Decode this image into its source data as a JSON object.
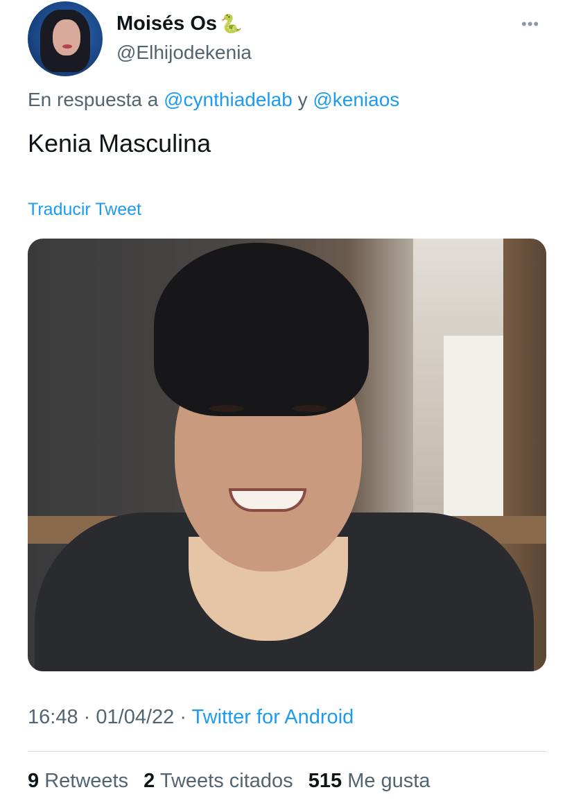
{
  "author": {
    "name": "Moisés Os",
    "emoji": "🐍",
    "handle": "@Elhijodekenia"
  },
  "reply": {
    "prefix": "En respuesta a",
    "user1": "@cynthiadelab",
    "conj": "y",
    "user2": "@keniaos"
  },
  "tweet": {
    "text": "Kenia Masculina",
    "translate_label": "Traducir Tweet"
  },
  "meta": {
    "time": "16:48",
    "date": "01/04/22",
    "source": "Twitter for Android",
    "sep": "·"
  },
  "stats": {
    "retweets_count": "9",
    "retweets_label": "Retweets",
    "quotes_count": "2",
    "quotes_label": "Tweets citados",
    "likes_count": "515",
    "likes_label": "Me gusta"
  },
  "icons": {
    "more": "more-icon",
    "avatar": "avatar"
  },
  "colors": {
    "link": "#1d9bf0",
    "secondary": "#536471",
    "primary": "#0f1419"
  }
}
